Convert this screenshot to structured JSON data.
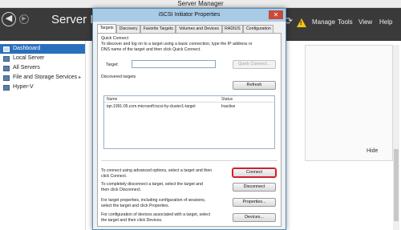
{
  "server_manager": {
    "window_title": "Server Manager",
    "header_title": "Server Manager",
    "menu": [
      "Manage",
      "Tools",
      "View",
      "Help"
    ],
    "nav": [
      {
        "label": "Dashboard",
        "active": true
      },
      {
        "label": "Local Server"
      },
      {
        "label": "All Servers"
      },
      {
        "label": "File and Storage Services",
        "expandable": true
      },
      {
        "label": "Hyper-V"
      }
    ],
    "hide_label": "Hide"
  },
  "dialog": {
    "title": "iSCSI Initiator Properties",
    "close_glyph": "✕",
    "tabs": [
      "Targets",
      "Discovery",
      "Favorite Targets",
      "Volumes and Devices",
      "RADIUS",
      "Configuration"
    ],
    "active_tab": "Targets",
    "quick_connect": {
      "heading": "Quick Connect",
      "description_1": "To discover and log on to a target using a basic connection, type the IP address or",
      "description_2": "DNS name of the target and then click Quick Connect.",
      "target_label": "Target:",
      "target_value": "",
      "button": "Quick Connect..."
    },
    "discovered": {
      "heading": "Discovered targets",
      "refresh_button": "Refresh",
      "columns": [
        "Name",
        "Status"
      ],
      "rows": [
        {
          "name": "iqn.1991-05.com.microsoft:iscsi-hy-cluster1-target",
          "status": "Inactive"
        }
      ]
    },
    "actions": [
      {
        "line1": "To connect using advanced options, select a target and then",
        "line2": "click Connect.",
        "button": "Connect"
      },
      {
        "line1": "To completely disconnect a target, select the target and",
        "line2": "then click Disconnect.",
        "button": "Disconnect"
      },
      {
        "line1": "For target properties, including configuration of sessions,",
        "line2": "select the target and click Properties.",
        "button": "Properties..."
      },
      {
        "line1": "For configuration of devices associated with a target, select",
        "line2": "the target and then click Devices.",
        "button": "Devices..."
      }
    ]
  }
}
